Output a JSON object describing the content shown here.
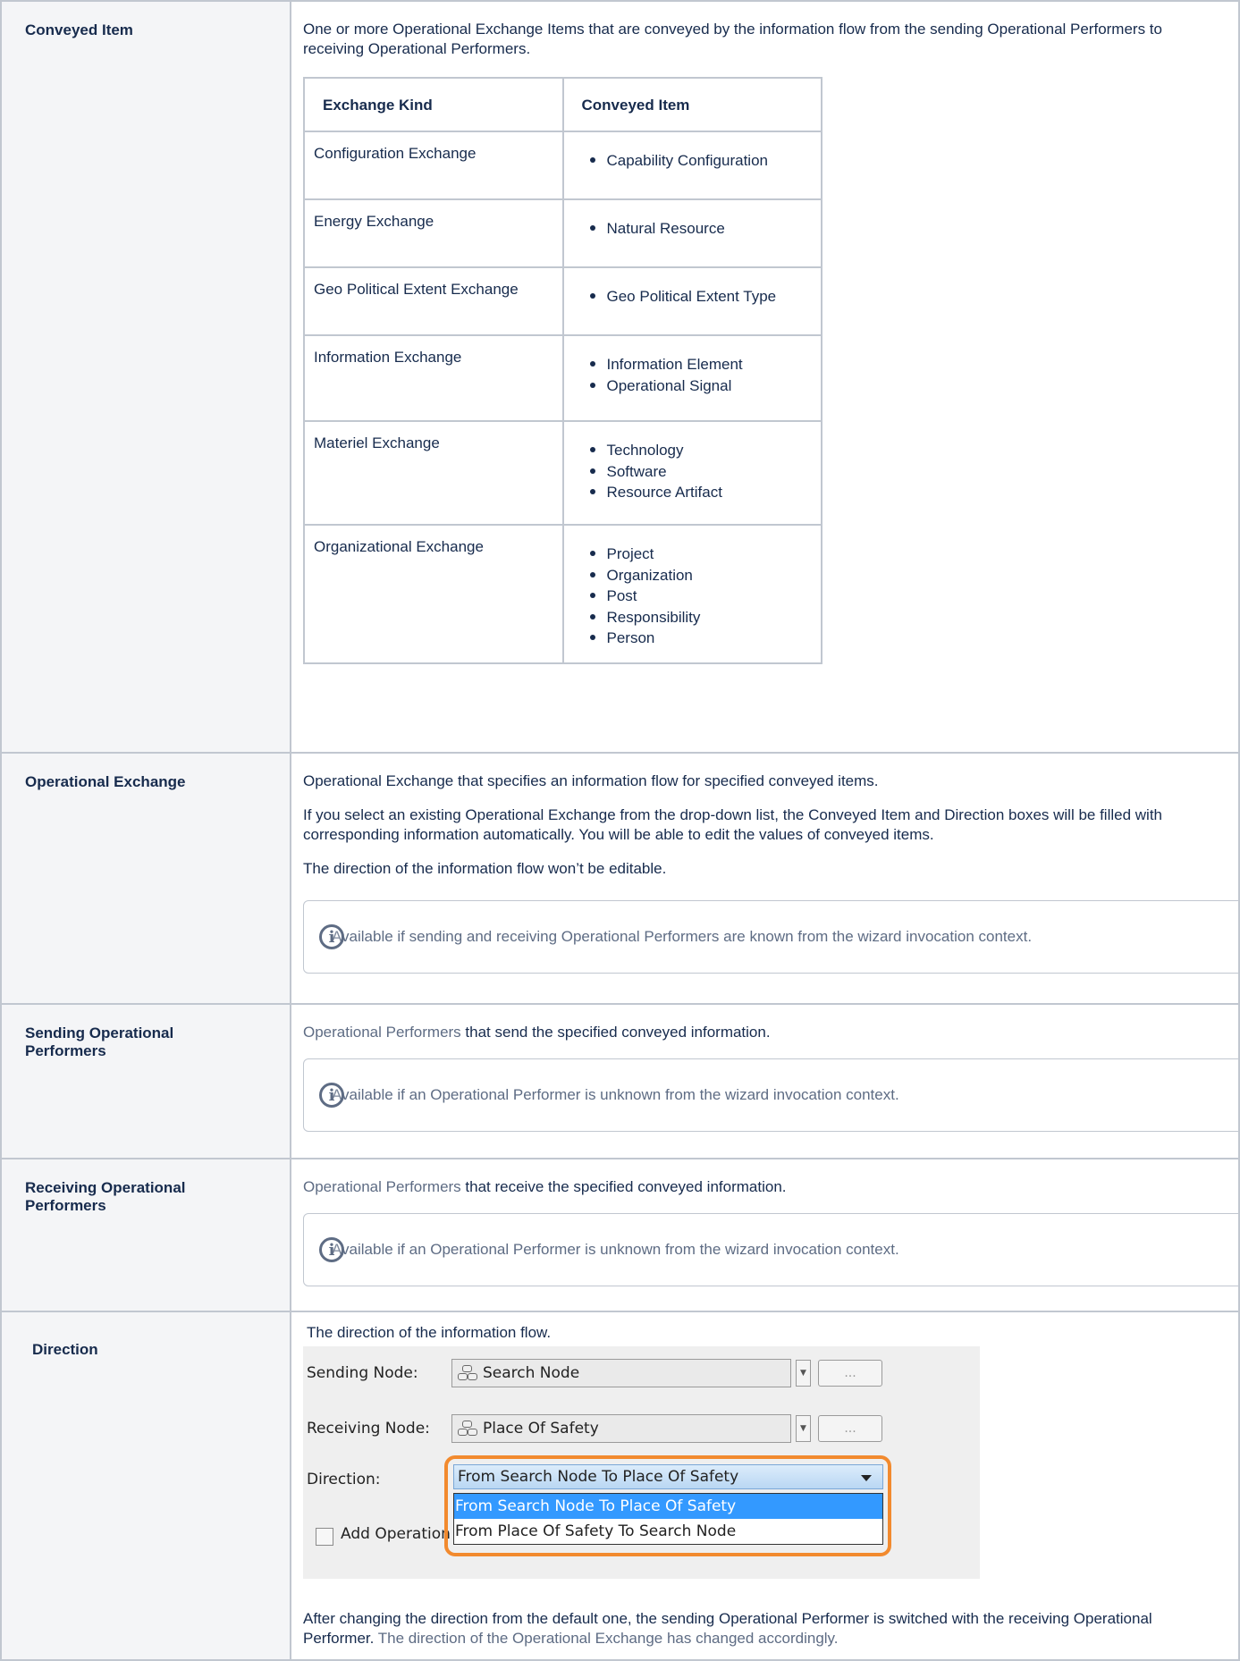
{
  "conveyed_item": {
    "label": "Conveyed Item",
    "description": "One or more Operational Exchange Items that are conveyed by the information flow from the sending Operational Performers to receiving Operational Performers.",
    "table": {
      "headers": [
        "Exchange Kind",
        "Conveyed Item"
      ],
      "rows": [
        {
          "kind": "Configuration Exchange",
          "items": [
            "Capability Configuration"
          ]
        },
        {
          "kind": "Energy Exchange",
          "items": [
            "Natural Resource"
          ]
        },
        {
          "kind": "Geo Political Extent Exchange",
          "items": [
            "Geo Political Extent Type"
          ]
        },
        {
          "kind": "Information Exchange",
          "items": [
            "Information Element",
            "Operational Signal"
          ]
        },
        {
          "kind": "Materiel Exchange",
          "items": [
            "Technology",
            "Software",
            "Resource Artifact"
          ]
        },
        {
          "kind": "Organizational Exchange",
          "items": [
            "Project",
            "Organization",
            "Post",
            "Responsibility",
            "Person"
          ]
        }
      ]
    }
  },
  "operational_exchange": {
    "label": "Operational Exchange",
    "p1": "Operational Exchange that specifies an information flow for specified conveyed items.",
    "p2": "If you select an existing Operational Exchange from the drop-down list, the Conveyed Item and Direction boxes will be filled with corresponding information automatically. You will be able to edit the values of conveyed items.",
    "p3": "The direction of the information flow won’t be editable.",
    "note": "Available if sending and receiving Operational Performers are known from the wizard invocation context."
  },
  "sending": {
    "label_line1": "Sending Operational",
    "label_line2": "Performers",
    "link": "Operational Performers",
    "text": " that send the specified conveyed information.",
    "note": "Available if an Operational Performer is unknown from the wizard invocation context."
  },
  "receiving": {
    "label_line1": "Receiving Operational",
    "label_line2": "Performers",
    "link": "Operational Performers",
    "text": " that receive the specified conveyed information.",
    "note": "Available if an Operational Performer is unknown from the wizard invocation context."
  },
  "direction": {
    "label": "Direction",
    "intro": "The direction of the information flow.",
    "ui": {
      "sending_label": "Sending Node:",
      "sending_value": "Search Node",
      "receiving_label": "Receiving Node:",
      "receiving_value": "Place Of Safety",
      "direction_label": "Direction:",
      "direction_value": "From Search Node To Place Of Safety",
      "options": [
        "From Search Node To Place Of Safety",
        "From Place Of Safety To Search Node"
      ],
      "checkbox_label": "Add Operation",
      "browse_label": "..."
    },
    "after_text": "After changing the direction from the default one, the sending Operational Performer is switched with the receiving Operational Performer.",
    "after_link": " The direction of the Operational Exchange has changed accordingly."
  }
}
